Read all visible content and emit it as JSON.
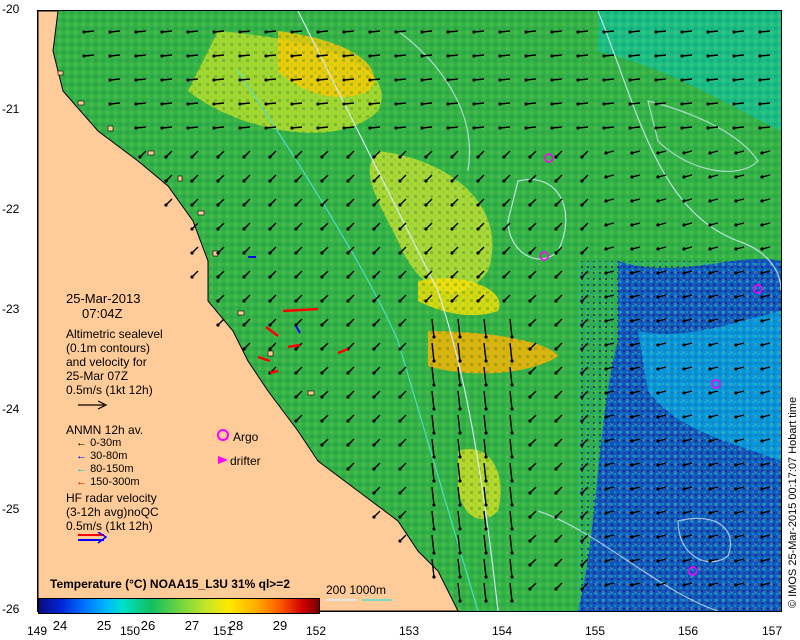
{
  "axes": {
    "x_ticks": [
      "149",
      "150",
      "151",
      "152",
      "153",
      "154",
      "155",
      "156",
      "157"
    ],
    "y_ticks": [
      "-20",
      "-21",
      "-22",
      "-23",
      "-24",
      "-25",
      "-26"
    ]
  },
  "map_region": {
    "lon_range": [
      149,
      157
    ],
    "lat_range": [
      -26,
      -20
    ]
  },
  "info": {
    "date": "25-Mar-2013",
    "time": "07:04Z",
    "altimetry_lines": [
      "Altimetric sealevel",
      "(0.1m contours)",
      "and velocity for",
      "25-Mar 07Z",
      "0.5m/s (1kt 12h)"
    ],
    "anmn_title": "ANMN 12h av.",
    "anmn_depths": [
      "0-30m",
      "30-80m",
      "80-150m",
      "150-300m"
    ],
    "argo_label": "Argo",
    "drifter_label": "drifter",
    "hf_lines": [
      "HF radar velocity",
      "(3-12h avg)noQC",
      "0.5m/s (1kt 12h)"
    ]
  },
  "colorbar": {
    "title": "Temperature (°C) NOAA15_L3U 31% ql>=2",
    "ticks": [
      "24",
      "25",
      "26",
      "27",
      "28",
      "29"
    ],
    "range": [
      23.5,
      29.9
    ]
  },
  "bathy_legend": {
    "label": "200  1000m"
  },
  "credit": "© IMOS 25-Mar-2015 00:17:07 Hobart time",
  "colors": {
    "land": "#ffcc99",
    "argo": "#ff00ff",
    "drifter": "#ff00ff",
    "anmn_0_30": "#000000",
    "anmn_30_80": "#0000ff",
    "anmn_80_150": "#00c8c8",
    "anmn_150_300": "#ff0000",
    "bathy_200": "#d8f0ff",
    "bathy_1000": "#50e0d0"
  },
  "argo_floats": [
    {
      "lon": 154.5,
      "lat": -21.47
    },
    {
      "lon": 154.45,
      "lat": -22.45
    },
    {
      "lon": 156.75,
      "lat": -22.78
    },
    {
      "lon": 156.3,
      "lat": -23.73
    },
    {
      "lon": 156.05,
      "lat": -25.6
    }
  ]
}
